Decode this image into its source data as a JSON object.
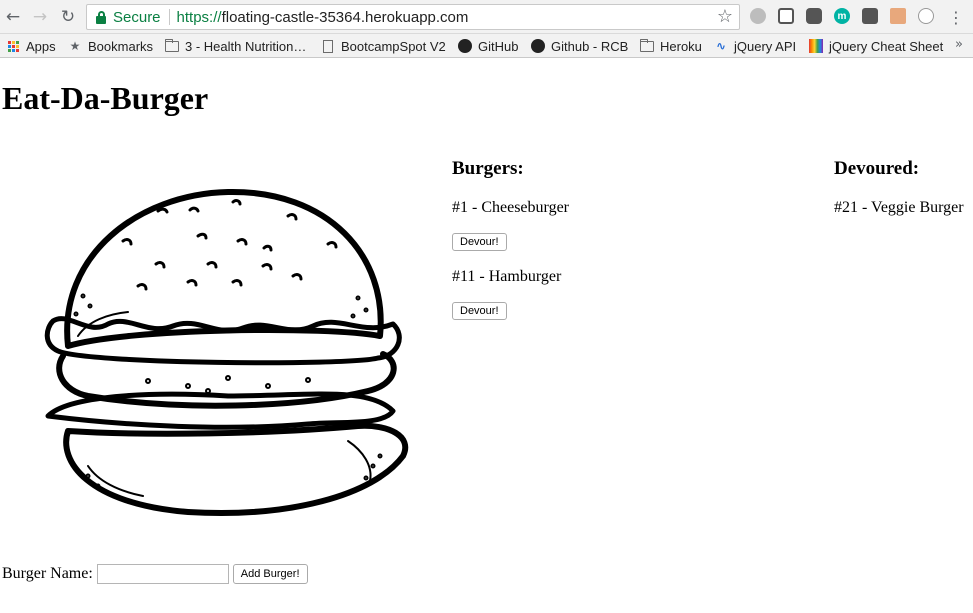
{
  "browser": {
    "secure_label": "Secure",
    "url_scheme": "https://",
    "url_host": "floating-castle-35364.herokuapp.com",
    "extensions": [
      {
        "name": "m",
        "color": "#00b3a4"
      }
    ]
  },
  "bookmarks": [
    {
      "label": "Apps",
      "icon": "apps-grid-icon"
    },
    {
      "label": "Bookmarks",
      "icon": "star-icon"
    },
    {
      "label": "3 - Health Nutrition…",
      "icon": "folder-icon"
    },
    {
      "label": "BootcampSpot V2",
      "icon": "page-icon"
    },
    {
      "label": "GitHub",
      "icon": "github-icon"
    },
    {
      "label": "Github - RCB",
      "icon": "github-icon"
    },
    {
      "label": "Heroku",
      "icon": "folder-icon"
    },
    {
      "label": "jQuery API",
      "icon": "jquery-icon"
    },
    {
      "label": "jQuery Cheat Sheet",
      "icon": "rainbow-icon"
    }
  ],
  "page": {
    "title": "Eat-Da-Burger",
    "burgers_heading": "Burgers:",
    "devoured_heading": "Devoured:",
    "burgers": [
      {
        "label": "#1 - Cheeseburger",
        "button": "Devour!"
      },
      {
        "label": "#11 - Hamburger",
        "button": "Devour!"
      }
    ],
    "devoured": [
      {
        "label": "#21 - Veggie Burger"
      }
    ],
    "form": {
      "label": "Burger Name:",
      "value": "",
      "button": "Add Burger!"
    }
  },
  "colors": {
    "secure_green": "#0b8043",
    "chrome_bg": "#f2f2f2"
  }
}
